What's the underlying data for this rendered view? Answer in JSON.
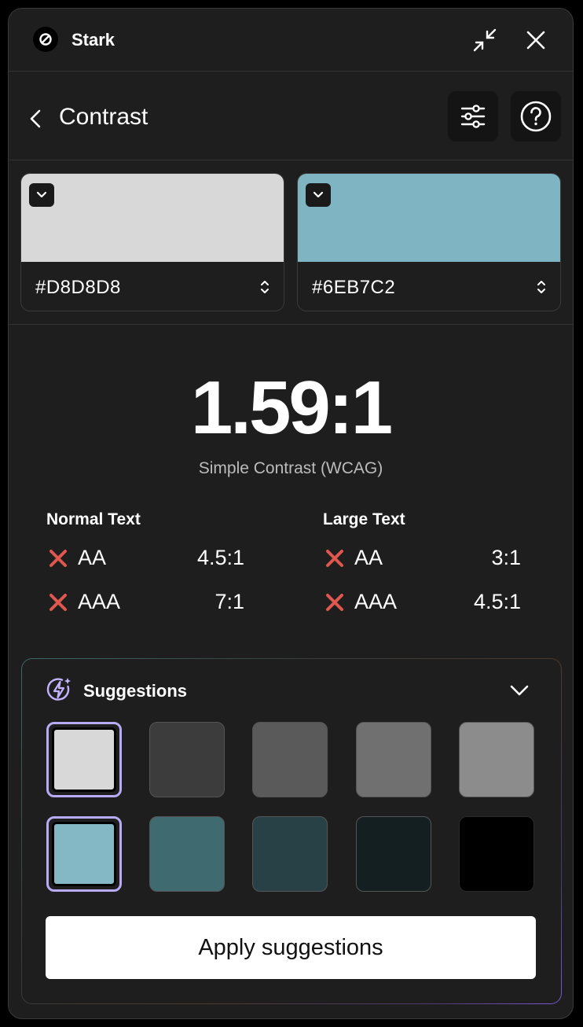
{
  "app": {
    "name": "Stark"
  },
  "header": {
    "title": "Contrast"
  },
  "colors": {
    "foreground": {
      "hex": "#D8D8D8",
      "swatch": "#d8d8d8"
    },
    "background": {
      "hex": "#6EB7C2",
      "swatch": "#7fb5c2"
    }
  },
  "result": {
    "ratio": "1.59:1",
    "method": "Simple Contrast (WCAG)"
  },
  "normal_text": {
    "label": "Normal Text",
    "rows": [
      {
        "level": "AA",
        "required": "4.5:1",
        "status": "fail"
      },
      {
        "level": "AAA",
        "required": "7:1",
        "status": "fail"
      }
    ]
  },
  "large_text": {
    "label": "Large Text",
    "rows": [
      {
        "level": "AA",
        "required": "3:1",
        "status": "fail"
      },
      {
        "level": "AAA",
        "required": "4.5:1",
        "status": "fail"
      }
    ]
  },
  "suggestions": {
    "title": "Suggestions",
    "foreground_row": [
      "#d8d8d8",
      "#3c3c3c",
      "#5a5a5a",
      "#707070",
      "#8c8c8c"
    ],
    "background_row": [
      "#84b8c4",
      "#3f6a70",
      "#284146",
      "#131f21",
      "#000000"
    ],
    "apply_label": "Apply suggestions"
  },
  "fail_color": "#e0574f"
}
